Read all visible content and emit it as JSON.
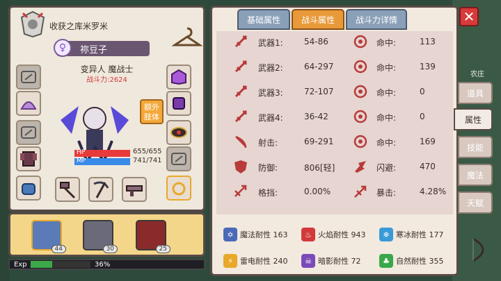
{
  "character": {
    "guild_name": "收获之库米罗米",
    "name": "祢豆子",
    "class_line": "变异人 魔战士",
    "power_label": "战斗力:",
    "power_value": "2624",
    "extra_limb_label": "额外肢体",
    "hp_label": "HP",
    "mp_label": "MP",
    "hp_text": "655/655",
    "mp_text": "741/741",
    "hp_fraction": 1.0,
    "mp_fraction": 1.0
  },
  "party": [
    {
      "level": "44",
      "color": "#5a7ab8"
    },
    {
      "level": "30",
      "color": "#6a6a7a"
    },
    {
      "level": "25",
      "color": "#8a2a2a"
    }
  ],
  "exp": {
    "label": "Exp",
    "percent_text": "36%",
    "fraction": 0.36
  },
  "tabs": [
    {
      "label": "基础属性",
      "active": false
    },
    {
      "label": "战斗属性",
      "active": true
    },
    {
      "label": "战斗力详情",
      "active": false
    }
  ],
  "stats_left": [
    {
      "label": "武器1:",
      "value": "54-86",
      "icon": "sword-icon"
    },
    {
      "label": "武器2:",
      "value": "64-297",
      "icon": "sword-icon"
    },
    {
      "label": "武器3:",
      "value": "72-107",
      "icon": "sword-icon"
    },
    {
      "label": "武器4:",
      "value": "36-42",
      "icon": "sword-icon"
    },
    {
      "label": "射击:",
      "value": "69-291",
      "icon": "bow-icon"
    },
    {
      "label": "防御:",
      "value": "806[轻]",
      "icon": "shield-icon"
    },
    {
      "label": "格挡:",
      "value": "0.00%",
      "icon": "block-icon"
    }
  ],
  "stats_right": [
    {
      "label": "命中:",
      "value": "113",
      "icon": "target-icon"
    },
    {
      "label": "命中:",
      "value": "139",
      "icon": "target-icon"
    },
    {
      "label": "命中:",
      "value": "0",
      "icon": "target-icon"
    },
    {
      "label": "命中:",
      "value": "0",
      "icon": "target-icon"
    },
    {
      "label": "命中:",
      "value": "169",
      "icon": "target-icon"
    },
    {
      "label": "闪避:",
      "value": "470",
      "icon": "dodge-icon"
    },
    {
      "label": "暴击:",
      "value": "4.28%",
      "icon": "crit-icon"
    }
  ],
  "resistances": [
    {
      "label": "魔法耐性 163",
      "color": "#4a6ab8",
      "glyph": "✡",
      "icon": "magic-resist-icon"
    },
    {
      "label": "火焰耐性 943",
      "color": "#d23a3a",
      "glyph": "♨",
      "icon": "fire-resist-icon"
    },
    {
      "label": "寒冰耐性 177",
      "color": "#3a9ad8",
      "glyph": "❄",
      "icon": "ice-resist-icon"
    },
    {
      "label": "雷电耐性 240",
      "color": "#e8a82a",
      "glyph": "⚡",
      "icon": "thunder-resist-icon"
    },
    {
      "label": "暗影耐性 72",
      "color": "#7a4ab8",
      "glyph": "☠",
      "icon": "shadow-resist-icon"
    },
    {
      "label": "自然耐性 355",
      "color": "#3aa84a",
      "glyph": "♣",
      "icon": "nature-resist-icon"
    }
  ],
  "side_tabs": [
    {
      "label": "道具",
      "active": false
    },
    {
      "label": "属性",
      "active": true
    },
    {
      "label": "技能",
      "active": false
    },
    {
      "label": "魔法",
      "active": false
    },
    {
      "label": "天赋",
      "active": false
    }
  ],
  "background": {
    "farm_label": "农庄"
  },
  "colors": {
    "hp": "#e83a3a",
    "mp": "#3a8ae8",
    "active_tab": "#e89a3a",
    "power": "#d23a3a"
  }
}
